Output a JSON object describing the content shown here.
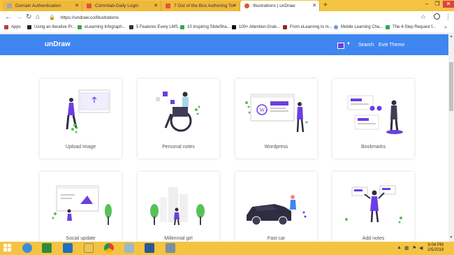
{
  "browser": {
    "tabs": [
      {
        "label": "Domain Authentication",
        "active": false,
        "favicon_color": "#9aa7b8"
      },
      {
        "label": "Commlab-Daily Login",
        "active": false,
        "favicon_color": "#e0533a"
      },
      {
        "label": "7 Out of the Box Authoring Tool",
        "active": false,
        "favicon_color": "#e0533a"
      },
      {
        "label": "Illustrations | unDraw",
        "active": true,
        "favicon_color": "#e0533a"
      }
    ],
    "url": "https://undraw.co/illustrations",
    "bookmarks": [
      {
        "label": "Apps",
        "icon_color": "#c53929"
      },
      {
        "label": "Using an Iterative Pr...",
        "icon_color": "#222222"
      },
      {
        "label": "eLearning Infograph...",
        "icon_color": "#37a84a"
      },
      {
        "label": "5 Features Every LMS...",
        "icon_color": "#333333"
      },
      {
        "label": "10 Inspiring SlideSha...",
        "icon_color": "#37a84a"
      },
      {
        "label": "100+ Attention-Grab...",
        "icon_color": "#111111"
      },
      {
        "label": "From eLearning to m...",
        "icon_color": "#8a2a2a"
      },
      {
        "label": "Mobile Learning Cha...",
        "icon_color": "#6c9bd2"
      },
      {
        "label": "The 4-Step Request f...",
        "icon_color": "#37a84a"
      }
    ],
    "bookmarks_more": "»"
  },
  "app": {
    "logo": "unDraw",
    "accent_color": "#6c3fe0",
    "header_color": "#3f86f0",
    "search_label": "Search",
    "theme_label": "Evie Theme"
  },
  "cards": [
    {
      "label": "Upload image"
    },
    {
      "label": "Personal notes"
    },
    {
      "label": "Wordpress"
    },
    {
      "label": "Bookmarks"
    },
    {
      "label": "Social update"
    },
    {
      "label": "Millennial girl"
    },
    {
      "label": "Fast car"
    },
    {
      "label": "Add notes"
    }
  ],
  "taskbar": {
    "time": "6:04 PM",
    "date": "2/5/2019",
    "apps": [
      "internet-explorer-icon",
      "project-icon",
      "outlook-icon",
      "file-explorer-icon",
      "chrome-icon",
      "notes-icon",
      "word-icon",
      "network-icon"
    ]
  }
}
